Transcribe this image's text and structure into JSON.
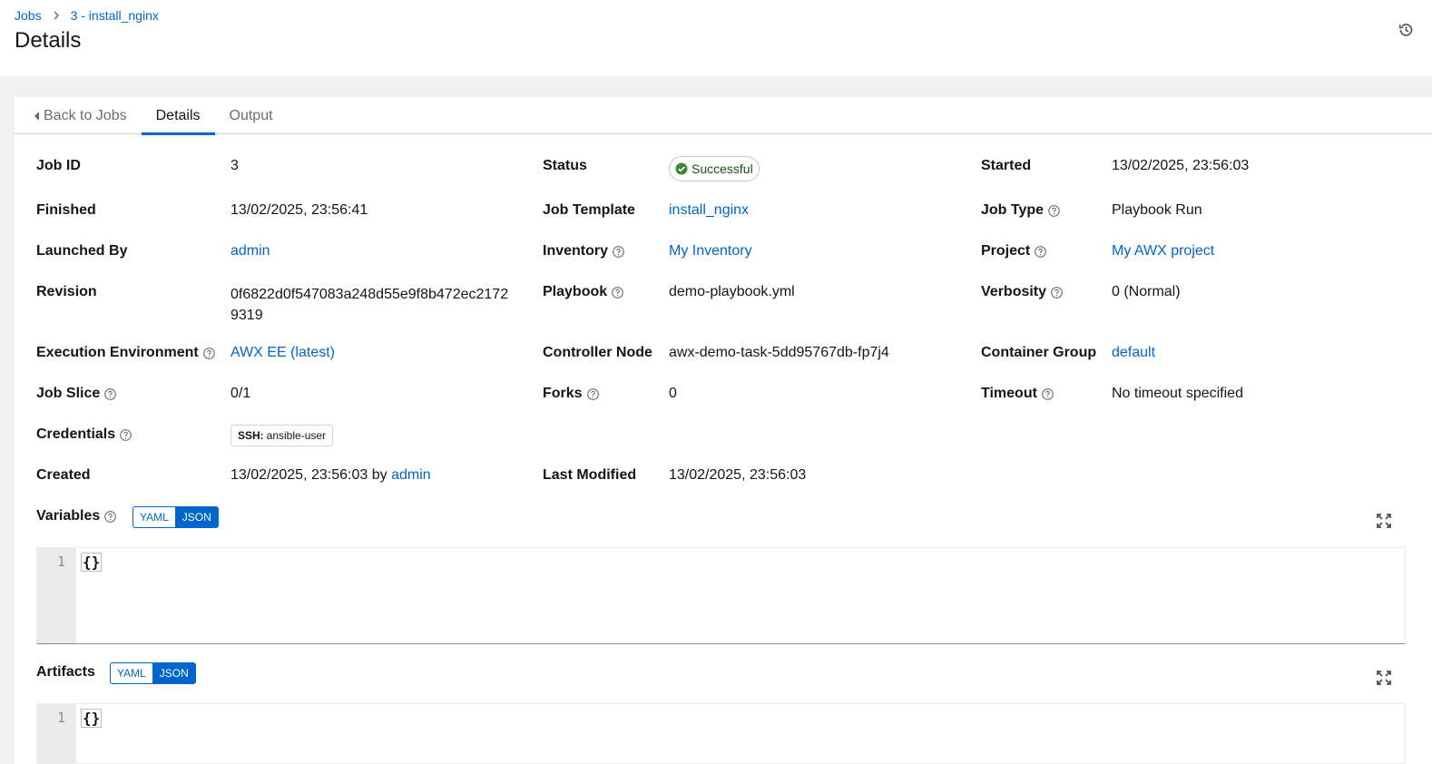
{
  "breadcrumb": {
    "root": "Jobs",
    "current": "3 - install_nginx"
  },
  "page_title": "Details",
  "tabs": {
    "back": "Back to Jobs",
    "details": "Details",
    "output": "Output"
  },
  "details": {
    "job_id": {
      "label": "Job ID",
      "value": "3"
    },
    "status": {
      "label": "Status",
      "value": "Successful"
    },
    "started": {
      "label": "Started",
      "value": "13/02/2025, 23:56:03"
    },
    "finished": {
      "label": "Finished",
      "value": "13/02/2025, 23:56:41"
    },
    "job_template": {
      "label": "Job Template",
      "value": "install_nginx"
    },
    "job_type": {
      "label": "Job Type",
      "value": "Playbook Run"
    },
    "launched_by": {
      "label": "Launched By",
      "value": "admin"
    },
    "inventory": {
      "label": "Inventory",
      "value": "My Inventory"
    },
    "project": {
      "label": "Project",
      "value": "My AWX project"
    },
    "revision": {
      "label": "Revision",
      "value_line1": "0f6822d0f547083a248d55e9f8b472ec2172",
      "value_line2": "9319"
    },
    "playbook": {
      "label": "Playbook",
      "value": "demo-playbook.yml"
    },
    "verbosity": {
      "label": "Verbosity",
      "value": "0 (Normal)"
    },
    "execution_environment": {
      "label": "Execution Environment",
      "value": "AWX EE (latest)"
    },
    "controller_node": {
      "label": "Controller Node",
      "value": "awx-demo-task-5dd95767db-fp7j4"
    },
    "container_group": {
      "label": "Container Group",
      "value": "default"
    },
    "job_slice": {
      "label": "Job Slice",
      "value": "0/1"
    },
    "forks": {
      "label": "Forks",
      "value": "0"
    },
    "timeout": {
      "label": "Timeout",
      "value": "No timeout specified"
    },
    "credentials": {
      "label": "Credentials",
      "chip_type": "SSH:",
      "chip_name": "ansible-user"
    },
    "created": {
      "label": "Created",
      "value": "13/02/2025, 23:56:03",
      "by": "by",
      "user": "admin"
    },
    "last_modified": {
      "label": "Last Modified",
      "value": "13/02/2025, 23:56:03"
    }
  },
  "variables": {
    "label": "Variables",
    "yaml": "YAML",
    "json": "JSON",
    "line_number": "1",
    "content": "{}"
  },
  "artifacts": {
    "label": "Artifacts",
    "yaml": "YAML",
    "json": "JSON",
    "line_number": "1",
    "content": "{}"
  },
  "colors": {
    "link": "#0066cc",
    "success": "#3e8635",
    "tab_active": "#0066cc"
  }
}
